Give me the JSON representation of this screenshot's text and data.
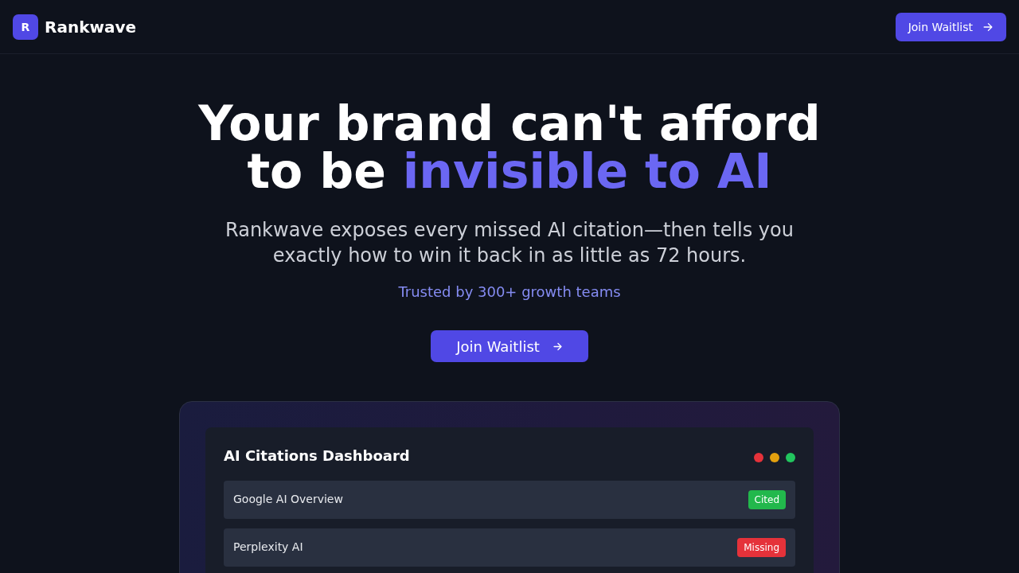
{
  "header": {
    "logo_letter": "R",
    "brand": "Rankwave",
    "button": {
      "label": "Join Waitlist"
    }
  },
  "hero": {
    "headline": [
      {
        "text": "Your brand can't afford to be ",
        "highlight": false
      },
      {
        "text": "invisible to AI",
        "highlight": true
      }
    ],
    "subtitle": "Rankwave exposes every missed AI citation—then tells you exactly how to win it back in as little as 72 hours.",
    "trust_line": "Trusted by 300+ growth teams",
    "cta": {
      "label": "Join Waitlist"
    }
  },
  "dashboard": {
    "title": "AI Citations Dashboard",
    "window_dots": [
      {
        "color": "#e5323a"
      },
      {
        "color": "#e3a00e"
      },
      {
        "color": "#22c55e"
      }
    ],
    "rows": [
      {
        "source": "Google AI Overview",
        "badge": {
          "label": "Cited",
          "color": "#22b84c"
        }
      },
      {
        "source": "Perplexity AI",
        "badge": {
          "label": "Missing",
          "color": "#e5323a"
        }
      }
    ]
  }
}
